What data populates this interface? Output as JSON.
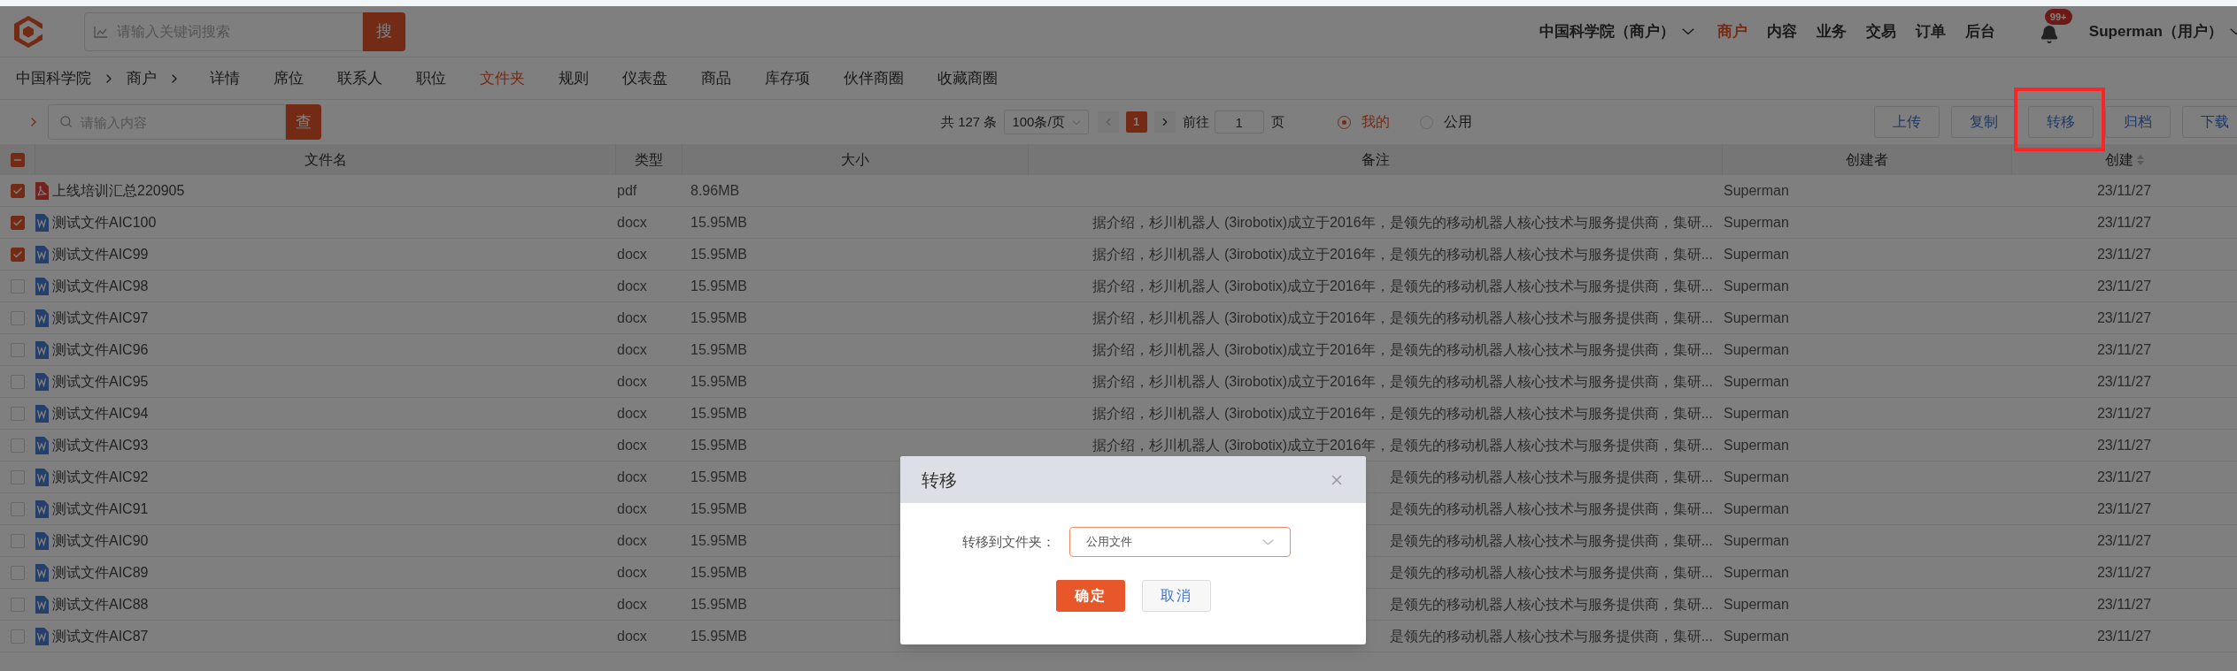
{
  "top_bar": {
    "search": {
      "placeholder": "请输入关键词搜索",
      "button": "搜"
    },
    "org_switch": "中国科学院（商户）",
    "menu": [
      {
        "label": "商户",
        "selected": true
      },
      {
        "label": "内容",
        "selected": false
      },
      {
        "label": "业务",
        "selected": false
      },
      {
        "label": "交易",
        "selected": false
      },
      {
        "label": "订单",
        "selected": false
      },
      {
        "label": "后台",
        "selected": false
      }
    ],
    "notifications": {
      "badge": "99+"
    },
    "user": "Superman（用户）"
  },
  "breadcrumb": [
    "中国科学院",
    "商户"
  ],
  "tabs": [
    {
      "label": "详情",
      "selected": false
    },
    {
      "label": "席位",
      "selected": false
    },
    {
      "label": "联系人",
      "selected": false
    },
    {
      "label": "职位",
      "selected": false
    },
    {
      "label": "文件夹",
      "selected": true
    },
    {
      "label": "规则",
      "selected": false
    },
    {
      "label": "仪表盘",
      "selected": false
    },
    {
      "label": "商品",
      "selected": false
    },
    {
      "label": "库存项",
      "selected": false
    },
    {
      "label": "伙伴商圈",
      "selected": false
    },
    {
      "label": "收藏商圈",
      "selected": false
    }
  ],
  "toolbar": {
    "search": {
      "placeholder": "请输入内容",
      "button": "查"
    },
    "total": "共 127 条",
    "page_size": "100条/页",
    "pages": [
      {
        "label": "1",
        "selected": true
      }
    ],
    "goto_label": "前往",
    "goto_value": "1",
    "goto_suffix": "页",
    "scope": [
      {
        "label": "我的",
        "selected": true
      },
      {
        "label": "公用",
        "selected": false
      }
    ],
    "actions": [
      {
        "label": "上传",
        "highlighted": false
      },
      {
        "label": "复制",
        "highlighted": false
      },
      {
        "label": "转移",
        "highlighted": true
      },
      {
        "label": "归档",
        "highlighted": false
      },
      {
        "label": "下载",
        "highlighted": false
      }
    ]
  },
  "table": {
    "select_all": {
      "indeterminate": true
    },
    "columns": [
      {
        "label": "文件名",
        "sortable": false
      },
      {
        "label": "类型",
        "sortable": false
      },
      {
        "label": "大小",
        "sortable": false
      },
      {
        "label": "备注",
        "sortable": false
      },
      {
        "label": "创建者",
        "sortable": false
      },
      {
        "label": "创建",
        "sortable": true
      }
    ],
    "rows": [
      {
        "kind": "pdf",
        "checked": true,
        "name": "上线培训汇总220905",
        "type": "pdf",
        "size": "8.96MB",
        "creator": "Superman",
        "created": "23/11/27"
      },
      {
        "kind": "word",
        "checked": true,
        "name": "测试文件AIC100",
        "type": "docx",
        "size": "15.95MB",
        "remark": "据介绍，杉川机器人 (3irobotix)成立于2016年，是领先的移动机器人核心技术与服务提供商，集研...",
        "creator": "Superman",
        "created": "23/11/27"
      },
      {
        "kind": "word",
        "checked": true,
        "name": "测试文件AIC99",
        "type": "docx",
        "size": "15.95MB",
        "remark": "据介绍，杉川机器人 (3irobotix)成立于2016年，是领先的移动机器人核心技术与服务提供商，集研...",
        "creator": "Superman",
        "created": "23/11/27"
      },
      {
        "kind": "word",
        "checked": false,
        "name": "测试文件AIC98",
        "type": "docx",
        "size": "15.95MB",
        "remark": "据介绍，杉川机器人 (3irobotix)成立于2016年，是领先的移动机器人核心技术与服务提供商，集研...",
        "creator": "Superman",
        "created": "23/11/27"
      },
      {
        "kind": "word",
        "checked": false,
        "name": "测试文件AIC97",
        "type": "docx",
        "size": "15.95MB",
        "remark": "据介绍，杉川机器人 (3irobotix)成立于2016年，是领先的移动机器人核心技术与服务提供商，集研...",
        "creator": "Superman",
        "created": "23/11/27"
      },
      {
        "kind": "word",
        "checked": false,
        "name": "测试文件AIC96",
        "type": "docx",
        "size": "15.95MB",
        "remark": "据介绍，杉川机器人 (3irobotix)成立于2016年，是领先的移动机器人核心技术与服务提供商，集研...",
        "creator": "Superman",
        "created": "23/11/27"
      },
      {
        "kind": "word",
        "checked": false,
        "name": "测试文件AIC95",
        "type": "docx",
        "size": "15.95MB",
        "remark": "据介绍，杉川机器人 (3irobotix)成立于2016年，是领先的移动机器人核心技术与服务提供商，集研...",
        "creator": "Superman",
        "created": "23/11/27"
      },
      {
        "kind": "word",
        "checked": false,
        "name": "测试文件AIC94",
        "type": "docx",
        "size": "15.95MB",
        "remark": "据介绍，杉川机器人 (3irobotix)成立于2016年，是领先的移动机器人核心技术与服务提供商，集研...",
        "creator": "Superman",
        "created": "23/11/27"
      },
      {
        "kind": "word",
        "checked": false,
        "name": "测试文件AIC93",
        "type": "docx",
        "size": "15.95MB",
        "remark": "据介绍，杉川机器人 (3irobotix)成立于2016年，是领先的移动机器人核心技术与服务提供商，集研...",
        "creator": "Superman",
        "created": "23/11/27"
      },
      {
        "kind": "word",
        "checked": false,
        "name": "测试文件AIC92",
        "type": "docx",
        "size": "15.95MB",
        "remark": "是领先的移动机器人核心技术与服务提供商，集研...",
        "creator": "Superman",
        "created": "23/11/27"
      },
      {
        "kind": "word",
        "checked": false,
        "name": "测试文件AIC91",
        "type": "docx",
        "size": "15.95MB",
        "remark": "是领先的移动机器人核心技术与服务提供商，集研...",
        "creator": "Superman",
        "created": "23/11/27"
      },
      {
        "kind": "word",
        "checked": false,
        "name": "测试文件AIC90",
        "type": "docx",
        "size": "15.95MB",
        "remark": "是领先的移动机器人核心技术与服务提供商，集研...",
        "creator": "Superman",
        "created": "23/11/27"
      },
      {
        "kind": "word",
        "checked": false,
        "name": "测试文件AIC89",
        "type": "docx",
        "size": "15.95MB",
        "remark": "是领先的移动机器人核心技术与服务提供商，集研...",
        "creator": "Superman",
        "created": "23/11/27"
      },
      {
        "kind": "word",
        "checked": false,
        "name": "测试文件AIC88",
        "type": "docx",
        "size": "15.95MB",
        "remark": "是领先的移动机器人核心技术与服务提供商，集研...",
        "creator": "Superman",
        "created": "23/11/27"
      },
      {
        "kind": "word",
        "checked": false,
        "name": "测试文件AIC87",
        "type": "docx",
        "size": "15.95MB",
        "remark": "是领先的移动机器人核心技术与服务提供商，集研...",
        "creator": "Superman",
        "created": "23/11/27"
      }
    ]
  },
  "dialog": {
    "title": "转移",
    "field_label": "转移到文件夹：",
    "field_value": "公用文件",
    "confirm": "确定",
    "cancel": "取消"
  }
}
